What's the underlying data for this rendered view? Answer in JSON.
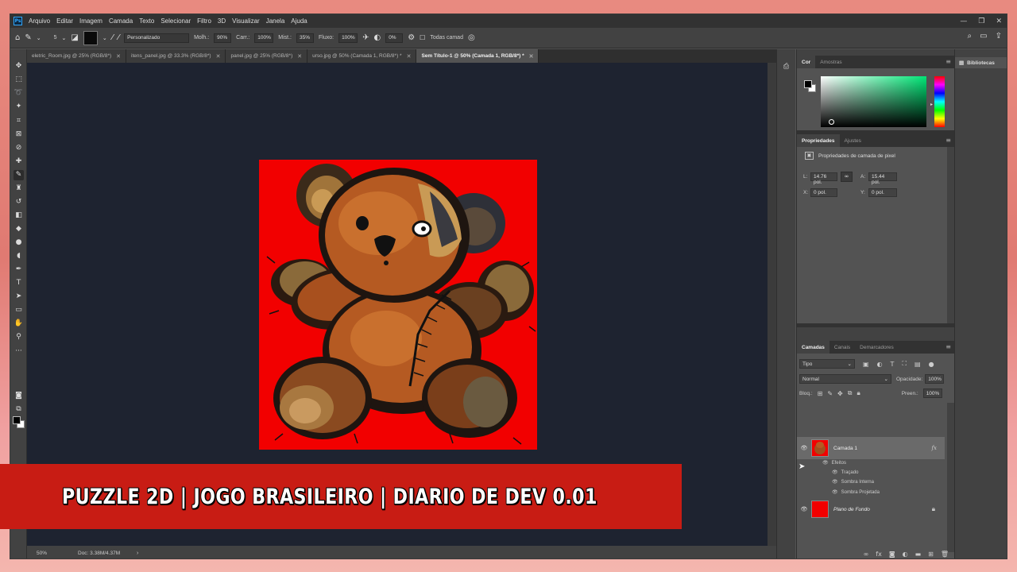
{
  "app": {
    "logo_text": "Ps",
    "menu": [
      "Arquivo",
      "Editar",
      "Imagem",
      "Camada",
      "Texto",
      "Selecionar",
      "Filtro",
      "3D",
      "Visualizar",
      "Janela",
      "Ajuda"
    ],
    "window_controls": [
      "—",
      "❐",
      "✕"
    ]
  },
  "options_bar": {
    "brush_size": "5",
    "preset": "Personalizado",
    "hardness_label": "Molh.:",
    "hardness_value": "90%",
    "load_label": "Carr.:",
    "load_value": "100%",
    "mix_label": "Mist.:",
    "mix_value": "35%",
    "flow_label": "Fluxo:",
    "flow_value": "100%",
    "angle_value": "0%",
    "sample_all_label": "Todas camad"
  },
  "tabs": [
    {
      "label": "eletric_Room.jpg @ 25% (RGB/8*)",
      "active": false
    },
    {
      "label": "itens_panel.jpg @ 33.3% (RGB/8*)",
      "active": false
    },
    {
      "label": "panel.jpg @ 25% (RGB/8*)",
      "active": false
    },
    {
      "label": "urso.jpg @ 50% (Camada 1, RGB/8*) *",
      "active": false
    },
    {
      "label": "Sem Título-1 @ 50% (Camada 1, RGB/8*) *",
      "active": true
    }
  ],
  "status": {
    "zoom": "50%",
    "doc": "Doc: 3.38M/4.37M",
    "arrow": "›"
  },
  "color_panel": {
    "tabs": [
      "Cor",
      "Amostras"
    ]
  },
  "properties_panel": {
    "tabs": [
      "Propriedades",
      "Ajustes"
    ],
    "title": "Propriedades de camada de pixel",
    "width_label": "L:",
    "width_value": "14.76 pol.",
    "height_label": "A:",
    "height_value": "15.44 pol.",
    "x_label": "X:",
    "x_value": "0 pol.",
    "y_label": "Y:",
    "y_value": "0 pol."
  },
  "layers_panel": {
    "tabs": [
      "Camadas",
      "Canais",
      "Demarcadores"
    ],
    "filter": "Tipo",
    "blend_mode": "Normal",
    "opacity_label": "Opacidade:",
    "opacity_value": "100%",
    "lock_label": "Bloq.:",
    "fill_label": "Preen.:",
    "fill_value": "100%",
    "layers": [
      {
        "name": "Camada 1",
        "fx": "fx"
      },
      {
        "name": "Plano de Fundo"
      }
    ],
    "effects_label": "Efeitos",
    "effects": [
      "Traçado",
      "Sombra Interna",
      "Sombra Projetada"
    ]
  },
  "libraries_label": "Bibliotecas",
  "banner": {
    "text": "PUZZLE 2D | JOGO BRASILEIRO | DIARIO DE DEV 0.01",
    "color": "#c81c14"
  },
  "colors": {
    "canvas_bg": "#f20000",
    "app_bg": "#535353",
    "workspace": "#1e2330"
  }
}
